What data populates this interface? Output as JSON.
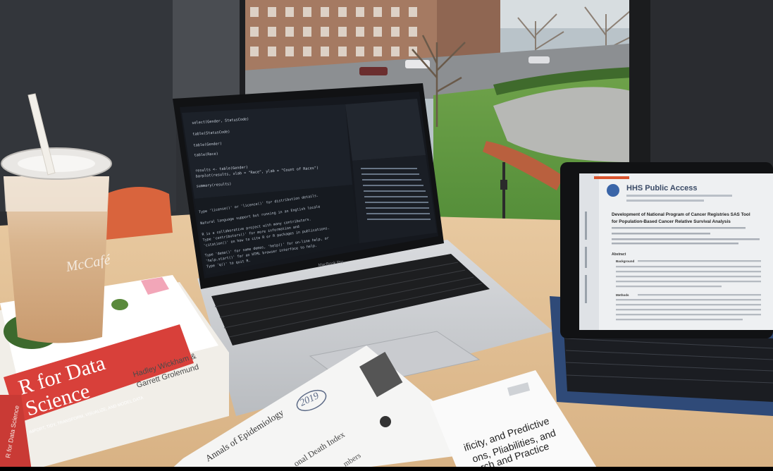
{
  "cup": {
    "brand": "McCafé"
  },
  "book": {
    "title_line1": "R for Data",
    "title_line2": "Science",
    "authors_line1": "Hadley Wickham &",
    "authors_line2": "Garrett Grolemund",
    "subtitle": "IMPORT, TIDY, TRANSFORM, VISUALIZE, AND MODEL DATA",
    "spine_text": "R for Data Science"
  },
  "laptop": {
    "model_label": "MacBook Pro",
    "code_lines": [
      "select(Gender, StatusCode)",
      "table(StatusCode)",
      "table(Gender)",
      "table(Race)",
      "results <- table(Gender)",
      "barplot(results, xlab = \"Race\", ylab = \"Count of Races\")",
      "summary(results)"
    ],
    "console_lines": [
      "Type 'license()' or 'licence()' for distribution details.",
      "Natural language support but running in an English locale",
      "R is a collaborative project with many contributors.",
      "Type 'contributors()' for more information and",
      "'citation()' on how to cite R or R packages in publications.",
      "Type 'demo()' for some demos, 'help()' for on-line help, or",
      "'help.start()' for an HTML browser interface to help.",
      "Type 'q()' to quit R."
    ]
  },
  "tablet": {
    "header": "HHS Public Access",
    "title_line1": "Development of National Program of Cancer Registries SAS Tool",
    "title_line2": "for Population-Based Cancer Relative Survival Analysis",
    "section_abstract": "Abstract",
    "section_background": "Background",
    "section_methods": "Methods"
  },
  "papers": {
    "handwritten_year": "2019",
    "journal": "Annals of Epidemiology",
    "left_title_fragment": "onal Death Index",
    "left_subtitle_fragment": "mbers",
    "right_title_line1": "ificity, and Predictive",
    "right_title_line2": "ons, Pliabilities, and",
    "right_title_line3": "rch and Practice"
  }
}
